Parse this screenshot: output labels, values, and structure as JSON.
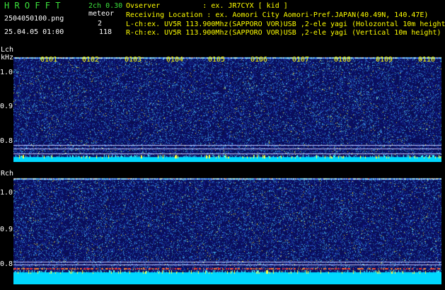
{
  "app": {
    "name": "H R O F F T",
    "version": "2ch 0.30",
    "filename": "2504050100.png",
    "datetime": "25.04.05 01:00",
    "counter_label": "meteor",
    "count_l": "2",
    "count_r": "118"
  },
  "header": {
    "observer": "Ovserver          : ex. JR7CYX [ kid ]",
    "location": "Receiving Location : ex. Aomori City Aomori-Pref.JAPAN(40.49N, 140.47E)",
    "lch": "L-ch:ex. UV5R 113.900Mhz(SAPPORO VOR)USB ,2-ele yagi (Holozontal 10m height",
    "rch": "R-ch:ex. UV5R 113.900Mhz(SAPPORO VOR)USB ,2-ele yagi (Vertical 10m height)"
  },
  "lch_panel": {
    "label": "Lch",
    "unit": "kHz",
    "yticks": [
      "1.0",
      "0.9",
      "0.8"
    ],
    "times": [
      "0101",
      "0102",
      "0103",
      "0104",
      "0105",
      "0106",
      "0107",
      "0108",
      "0109",
      "0110"
    ]
  },
  "rch_panel": {
    "label": "Rch",
    "yticks": [
      "1.0",
      "0.9",
      "0.8"
    ]
  },
  "colors": {
    "background": "#000000",
    "title_green": "#3ce33c",
    "time_yellow": "#ffff00",
    "noise_blue": "#1a1f8c",
    "base_cyan": "#00d8ff"
  }
}
